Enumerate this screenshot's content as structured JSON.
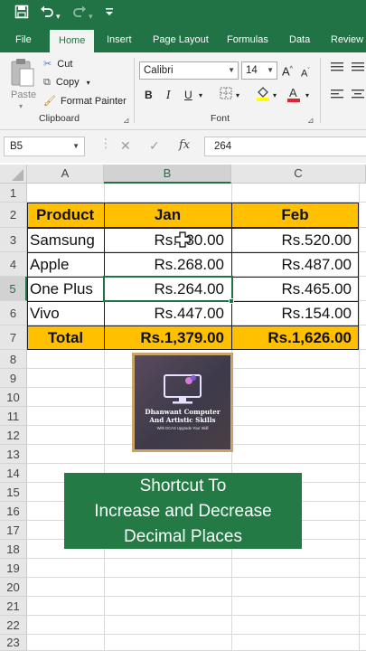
{
  "qat": {
    "save_icon": "save-icon",
    "undo_icon": "undo-icon",
    "redo_icon": "redo-icon",
    "customize_icon": "customize-qat-icon"
  },
  "tabs": [
    "File",
    "Home",
    "Insert",
    "Page Layout",
    "Formulas",
    "Data",
    "Review"
  ],
  "active_tab": "Home",
  "ribbon": {
    "clipboard": {
      "paste": "Paste",
      "cut": "Cut",
      "copy": "Copy",
      "format_painter": "Format Painter",
      "group_label": "Clipboard"
    },
    "font": {
      "font_name": "Calibri",
      "font_size": "14",
      "bold": "B",
      "italic": "I",
      "underline": "U",
      "group_label": "Font"
    }
  },
  "formula_bar": {
    "name_box": "B5",
    "fx_label": "fx",
    "value": "264"
  },
  "columns": [
    "A",
    "B",
    "C"
  ],
  "selected_column": "B",
  "rows": [
    "1",
    "2",
    "3",
    "4",
    "5",
    "6",
    "7",
    "8",
    "9",
    "10",
    "11",
    "12",
    "13",
    "14",
    "15",
    "16",
    "17",
    "18",
    "19",
    "20",
    "21",
    "22",
    "23"
  ],
  "selected_row": "5",
  "table": {
    "headers": [
      "Product",
      "Jan",
      "Feb"
    ],
    "data": [
      [
        "Samsung",
        "Rs.430.00",
        "Rs.520.00"
      ],
      [
        "Apple",
        "Rs.268.00",
        "Rs.487.00"
      ],
      [
        "One Plus",
        "Rs.264.00",
        "Rs.465.00"
      ],
      [
        "Vivo",
        "Rs.447.00",
        "Rs.154.00"
      ]
    ],
    "total": [
      "Total",
      "Rs.1,379.00",
      "Rs.1,626.00"
    ]
  },
  "logo": {
    "line1": "Dhanwant Computer",
    "line2": "And Artistic Skills",
    "line3": "With DCAS Upgrade Your Skill"
  },
  "banner": {
    "line1": "Shortcut To",
    "line2": "Increase and Decrease",
    "line3": "Decimal Places"
  },
  "colors": {
    "excel_green": "#217346",
    "header_fill": "#ffc000",
    "banner_green": "#237a45"
  }
}
